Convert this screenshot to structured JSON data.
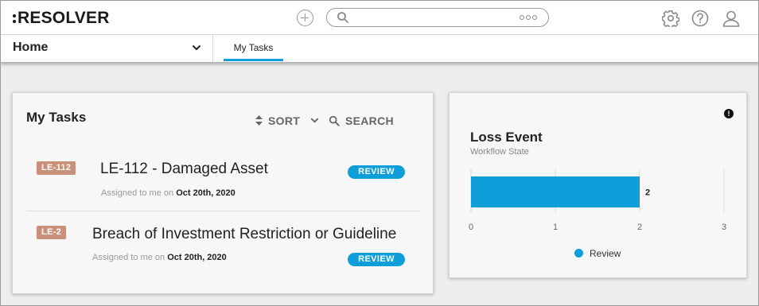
{
  "app": {
    "logo_text": "RESOLVER"
  },
  "header": {
    "add_icon": "plus-circle-icon",
    "search": {
      "placeholder": "",
      "value": ""
    },
    "icons": [
      "gear-icon",
      "help-icon",
      "user-icon"
    ]
  },
  "nav": {
    "home_label": "Home",
    "tabs": [
      {
        "label": "My Tasks",
        "active": true
      }
    ]
  },
  "tasks_card": {
    "title": "My Tasks",
    "sort_label": "SORT",
    "search_label": "SEARCH",
    "tasks": [
      {
        "id": "LE-112",
        "name": "LE-112 - Damaged Asset",
        "assigned_prefix": "Assigned to me on",
        "assigned_date": "Oct 20th, 2020",
        "status": "REVIEW"
      },
      {
        "id": "LE-2",
        "name": "Breach of Investment Restriction or Guideline",
        "assigned_prefix": "Assigned to me on",
        "assigned_date": "Oct 20th, 2020",
        "status": "REVIEW"
      }
    ]
  },
  "loss_card": {
    "title": "Loss Event",
    "subtitle": "Workflow State",
    "info_glyph": "!"
  },
  "chart_data": {
    "type": "bar",
    "orientation": "horizontal",
    "categories": [
      "Review"
    ],
    "series": [
      {
        "name": "Review",
        "values": [
          2
        ]
      }
    ],
    "data_labels": [
      "2"
    ],
    "xlim": [
      0,
      3
    ],
    "x_ticks": [
      "0",
      "1",
      "2",
      "3"
    ],
    "grid": true,
    "legend": "bottom-center",
    "color": "#0e9fdb"
  },
  "colors": {
    "accent": "#0e9fdb",
    "id_badge": "#c9907a",
    "background": "#eeeeee"
  }
}
